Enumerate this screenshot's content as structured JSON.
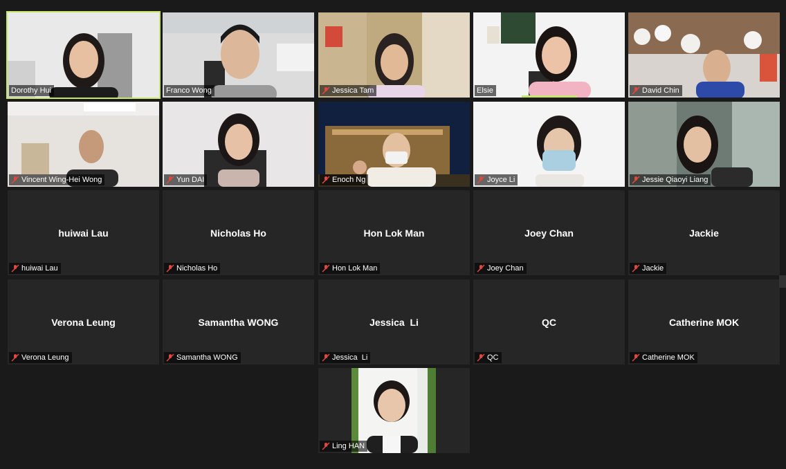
{
  "colors": {
    "background": "#1a1a1a",
    "tile_off": "#262626",
    "active_speaker": "#c8e66a",
    "muted_icon": "#e5463c"
  },
  "participants": [
    {
      "name": "Dorothy Hui",
      "muted": false,
      "video": true,
      "speaking": true
    },
    {
      "name": "Franco Wong",
      "muted": false,
      "video": true
    },
    {
      "name": "Jessica Tam",
      "muted": true,
      "video": true
    },
    {
      "name": "Elsie",
      "muted": false,
      "video": true
    },
    {
      "name": "David Chin",
      "muted": true,
      "video": true
    },
    {
      "name": "Vincent Wing-Hei Wong",
      "muted": true,
      "video": true
    },
    {
      "name": "Yun DAI",
      "muted": true,
      "video": true
    },
    {
      "name": "Enoch Ng",
      "muted": true,
      "video": true
    },
    {
      "name": "Joyce Li",
      "muted": true,
      "video": true
    },
    {
      "name": "Jessie Qiaoyi Liang",
      "muted": true,
      "video": true
    },
    {
      "name": "huiwai Lau",
      "muted": true,
      "video": false
    },
    {
      "name": "Nicholas Ho",
      "muted": true,
      "video": false
    },
    {
      "name": "Hon Lok Man",
      "muted": true,
      "video": false
    },
    {
      "name": "Joey Chan",
      "muted": true,
      "video": false
    },
    {
      "name": "Jackie",
      "muted": true,
      "video": false
    },
    {
      "name": "Verona Leung",
      "muted": true,
      "video": false
    },
    {
      "name": "Samantha WONG",
      "muted": true,
      "video": false
    },
    {
      "name": "Jessica  Li",
      "muted": true,
      "video": false
    },
    {
      "name": "QC",
      "muted": true,
      "video": false
    },
    {
      "name": "Catherine MOK",
      "muted": true,
      "video": false
    },
    {
      "name": "Ling HAN",
      "muted": true,
      "video": true,
      "photo": true
    }
  ]
}
